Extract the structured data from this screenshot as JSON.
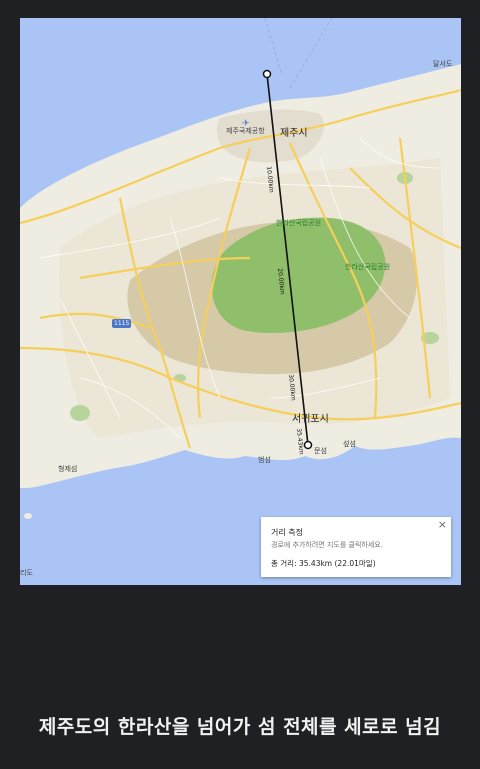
{
  "map": {
    "place_labels": {
      "jeju_city": "제주시",
      "jeju_airport": "제주국제공항",
      "seogwipo": "서귀포시",
      "hallasan_park_1": "한라산국립공원",
      "hallasan_park_2": "한라산국립공원",
      "hyeongje_island": "형제섬",
      "beom_island": "범섬",
      "seop_island": "섶섬",
      "moon_island": "문섬",
      "dalsseom": "달서도",
      "left_edge_label": "리도"
    },
    "highway_badge": "1115",
    "distance_markers": [
      "10.00km",
      "20.00km",
      "30.00km",
      "35.43km"
    ]
  },
  "measure_panel": {
    "title": "거리 측정",
    "hint": "경로에 추가하려면 지도를 클릭하세요.",
    "total": "총 거리: 35.43km (22.01마일)",
    "close_symbol": "×"
  },
  "caption": "제주도의 한라산을 넘어가 섬 전체를 세로로 넘김",
  "colors": {
    "sea": "#a9c4f5",
    "land": "#efece2",
    "park": "#8fbf6a",
    "mountain_shade": "#d6c9a8",
    "road": "#f6cf5a",
    "measure_line": "#111111",
    "background": "#1f2023"
  }
}
